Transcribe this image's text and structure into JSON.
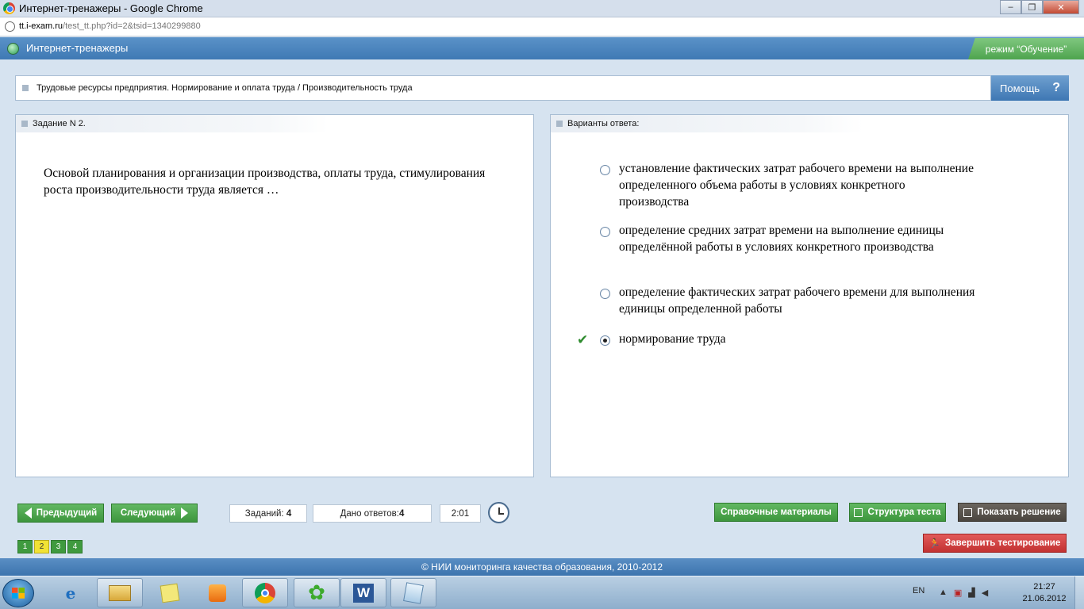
{
  "window": {
    "title": "Интернет-тренажеры - Google Chrome"
  },
  "browser": {
    "url_host": "tt.i-exam.ru",
    "url_path": "/test_tt.php?id=2&tsid=1340299880"
  },
  "app": {
    "name": "Интернет-тренажеры",
    "mode": "режим “Обучение”"
  },
  "breadcrumb": {
    "text": "Трудовые ресурсы предприятия. Нормирование и оплата труда / Производительность труда"
  },
  "help": {
    "label": "Помощь",
    "icon_glyph": "?"
  },
  "task": {
    "header": "Задание N 2.",
    "question": "Основой планирования и организации производства, оплаты труда, стимулирования роста производительности труда является …"
  },
  "answers": {
    "header": "Варианты ответа:",
    "options": [
      {
        "text": "установление фактических затрат рабочего времени на выполнение определенного объема работы в условиях конкретного производства",
        "selected": false,
        "correct": false
      },
      {
        "text": "определение средних затрат времени на выполнение единицы определённой работы в условиях конкретного производства",
        "selected": false,
        "correct": false
      },
      {
        "text": "определение фактических затрат рабочего времени для выполнения единицы определенной работы",
        "selected": false,
        "correct": false
      },
      {
        "text": "нормирование труда",
        "selected": true,
        "correct": true
      }
    ]
  },
  "toolbar": {
    "prev_label": "Предыдущий",
    "next_label": "Следующий",
    "tasks_label": "Заданий:",
    "tasks_count": "4",
    "answered_label": "Дано ответов:",
    "answered_count": "4",
    "timer": "2:01",
    "reference_label": "Справочные материалы",
    "structure_label": "Структура теста",
    "solution_label": "Показать решение",
    "finish_label": "Завершить тестирование"
  },
  "pager": {
    "pages": [
      "1",
      "2",
      "3",
      "4"
    ],
    "current": "2"
  },
  "footer": {
    "text": "© НИИ мониторинга качества образования, 2010-2012"
  },
  "taskbar": {
    "lang": "EN",
    "time": "21:27",
    "date": "21.06.2012",
    "apps": [
      "start-button",
      "internet-explorer",
      "file-explorer",
      "sticky-notes",
      "media-player",
      "google-chrome",
      "icq",
      "microsoft-word",
      "notepad"
    ]
  },
  "colors": {
    "accent_blue": "#3f79b4",
    "green": "#4ea44e",
    "finish_red": "#c23131",
    "current_page": "#f1e234"
  }
}
